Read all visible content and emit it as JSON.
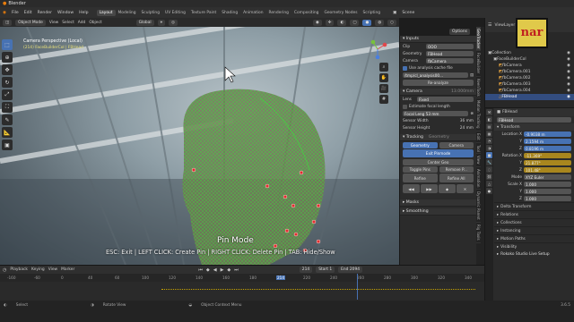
{
  "window": {
    "title": "Blender"
  },
  "menu": [
    "File",
    "Edit",
    "Render",
    "Window",
    "Help"
  ],
  "workspaces": [
    "Layout",
    "Modeling",
    "Sculpting",
    "UV Editing",
    "Texture Paint",
    "Shading",
    "Animation",
    "Rendering",
    "Compositing",
    "Geometry Nodes",
    "Scripting"
  ],
  "active_workspace": "Layout",
  "scene": {
    "label": "Scene",
    "view_layer": "ViewLayer"
  },
  "viewport": {
    "mode": "Object Mode",
    "menus": [
      "View",
      "Select",
      "Add",
      "Object"
    ],
    "orientation": "Global",
    "overlay_title": "Camera Perspective (Local)",
    "overlay_sub": "(214) FaceBuilderCol | FBHead",
    "options_label": "Options",
    "pin_mode": "Pin Mode",
    "hint": "ESC: Exit | LEFT CLICK: Create Pin | RIGHT CLICK: Delete Pin | TAB: Hide/Show"
  },
  "npanel": {
    "inputs_header": "Inputs",
    "clip_label": "Clip",
    "clip_value": "OOO",
    "geometry_label": "Geometry",
    "geometry_value": "FBHead",
    "camera_label": "Camera",
    "camera_value": "fbCamera",
    "cache_label": "Use analysis cache file",
    "cache_path": "/tmp/cl_analysis00...",
    "reanalyze": "Re-analyze",
    "camera_header": "Camera",
    "camera_header_value": "13.000mm",
    "lens_label": "Lens",
    "lens_value": "Fixed",
    "estimate_label": "Estimate focal length",
    "focal_label": "Focal Leng",
    "focal_value": "53 mm",
    "sensor_w_label": "Sensor Width",
    "sensor_w_value": "36 mm",
    "sensor_h_label": "Sensor Height",
    "sensor_h_value": "24 mm",
    "tracking_header": "Tracking",
    "tracking_sub": "Geometry",
    "geometry_btn": "Geometry",
    "camera_btn": "Camera",
    "exit_pinmode": "Exit Pinmode",
    "center_geo": "Center Geo",
    "toggle_pins": "Toggle Pins",
    "remove_pins": "Remove P...",
    "refine": "Refine",
    "refine_all": "Refine All",
    "masks": "Masks",
    "smoothing": "Smoothing"
  },
  "vtabs": [
    "GeoTracker",
    "FaceBuilder",
    "KeenTools",
    "Motion Tracking",
    "Edit",
    "Tool",
    "View",
    "Animation",
    "Dynamic Parent",
    "Rig Tools"
  ],
  "outliner": {
    "rows": [
      {
        "label": "Collection",
        "indent": 0
      },
      {
        "label": "FaceBuilderCol",
        "indent": 1
      },
      {
        "label": "fbCamera",
        "indent": 2
      },
      {
        "label": "fbCamera.001",
        "indent": 2
      },
      {
        "label": "fbCamera.002",
        "indent": 2
      },
      {
        "label": "fbCamera.003",
        "indent": 2
      },
      {
        "label": "fbCamera.004",
        "indent": 2
      },
      {
        "label": "FBHead",
        "indent": 2,
        "selected": true
      }
    ]
  },
  "properties": {
    "object_name": "FBHead",
    "object_field": "FBHead",
    "transform_header": "Transform",
    "location_label": "Location X",
    "location": [
      "-0.9038 m",
      "2.1594 m",
      "0.8196 m"
    ],
    "rotation_label": "Rotation X",
    "rotation": [
      "-11.369°",
      "21.877°",
      "101.48°"
    ],
    "mode_label": "Mode",
    "mode_value": "XYZ Euler",
    "scale_label": "Scale X",
    "scale": [
      "1.000",
      "1.000",
      "1.000"
    ],
    "sections": [
      "Delta Transform",
      "Relations",
      "Collections",
      "Instancing",
      "Motion Paths",
      "Visibility"
    ],
    "footer": "Rokoko Studio Live Setup"
  },
  "timeline": {
    "menus": [
      "Playback",
      "Keying",
      "View",
      "Marker"
    ],
    "current_frame": "214",
    "start_label": "Start",
    "start_value": "1",
    "end_label": "End",
    "end_value": "2094",
    "ticks": [
      "-160",
      "-60",
      "0",
      "40",
      "60",
      "100",
      "120",
      "140",
      "160",
      "180",
      "214",
      "220",
      "240",
      "260",
      "280",
      "300",
      "320",
      "340"
    ]
  },
  "status": [
    "Select",
    "Rotate View",
    "Object Context Menu"
  ],
  "version": "3.6.5",
  "colors": {
    "accent": "#4772b3",
    "selected": "#334d80",
    "mesh": "#3ddc3d",
    "pin": "#e03030"
  },
  "logo_text": "nar"
}
